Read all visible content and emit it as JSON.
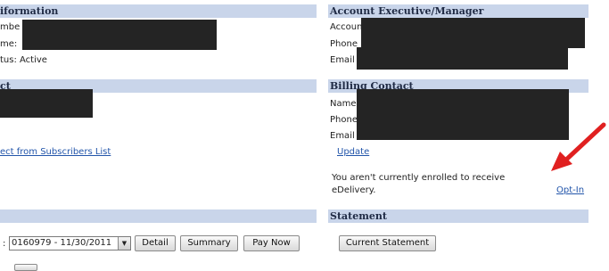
{
  "left_info": {
    "header": "iformation",
    "row1_label": "mbe",
    "row2_label": "me:",
    "row3": "tus: Active"
  },
  "left_contact": {
    "header": "ct",
    "link": "ect from Subscribers List"
  },
  "account_exec": {
    "header": "Account Executive/Manager",
    "account_label": "Account",
    "phone_label": "Phone",
    "email_label": "Email"
  },
  "billing": {
    "header": "Billing Contact",
    "name_label": "Name",
    "phone_label": "Phone",
    "email_label": "Email",
    "update_link": "Update",
    "notice_line1": "You aren't currently enrolled to receive",
    "notice_line2": "eDelivery.",
    "optin_link": "Opt-In"
  },
  "statement": {
    "header": "Statement",
    "current_button": "Current Statement"
  },
  "invoice_row": {
    "prefix": ":",
    "selected_invoice": "0160979 - 11/30/2011",
    "detail_button": "Detail",
    "summary_button": "Summary",
    "pay_button": "Pay Now"
  },
  "colors": {
    "header_bg": "#c9d5ea",
    "link": "#2255aa",
    "arrow": "#e02020",
    "redaction": "#242424"
  }
}
